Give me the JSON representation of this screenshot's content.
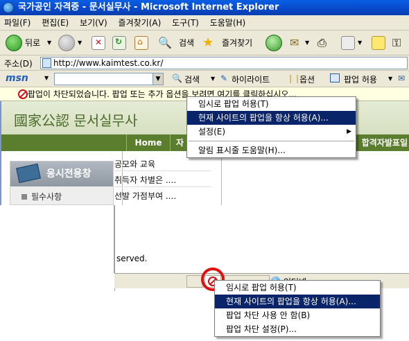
{
  "window": {
    "title": "국가공인 자격증 - 문서실무사 - Microsoft Internet Explorer"
  },
  "menubar": {
    "items": [
      "파일(F)",
      "편집(E)",
      "보기(V)",
      "즐겨찾기(A)",
      "도구(T)",
      "도움말(H)"
    ]
  },
  "toolbar": {
    "back": "뒤로",
    "search": "검색",
    "favorites": "즐겨찾기"
  },
  "address": {
    "label": "주소(D)",
    "url": "http://www.kaimtest.co.kr/"
  },
  "msn": {
    "logo": "msn",
    "search": "검색",
    "highlight": "하이라이트",
    "options": "옵션",
    "popup_allow": "팝업 허용"
  },
  "infobar": {
    "text": "팝업이 차단되었습니다.  팝업 또는 추가 옵션을 보려면 여기를 클릭하십시오..."
  },
  "site": {
    "logo": "國家公認 문서실무사",
    "nav_home": "Home",
    "nav_cut": "자",
    "nav_right": "합격자발표일",
    "side_title": "응시전용창",
    "side_sub": "필수사항",
    "news": [
      "공모와 교육",
      "취득자 차별은 ....",
      "선발 가점부여 ...."
    ],
    "footer": "served.",
    "status_zone": "인터넷"
  },
  "menu_top": {
    "items": [
      {
        "label": "임시로 팝업 허용(T)",
        "selected": false
      },
      {
        "label": "현재 사이트의 팝업을 항상 허용(A)...",
        "selected": true
      },
      {
        "label": "설정(E)",
        "selected": false,
        "submenu": true
      },
      {
        "label": "알림 표시줄 도움말(H)...",
        "selected": false
      }
    ]
  },
  "menu_bottom": {
    "items": [
      {
        "label": "임시로 팝업 허용(T)",
        "selected": false
      },
      {
        "label": "현재 사이트의 팝업을 항상 허용(A)...",
        "selected": true
      },
      {
        "label": "팝업 차단 사용 안 함(B)",
        "selected": false
      },
      {
        "label": "팝업 차단 설정(P)...",
        "selected": false
      }
    ]
  }
}
